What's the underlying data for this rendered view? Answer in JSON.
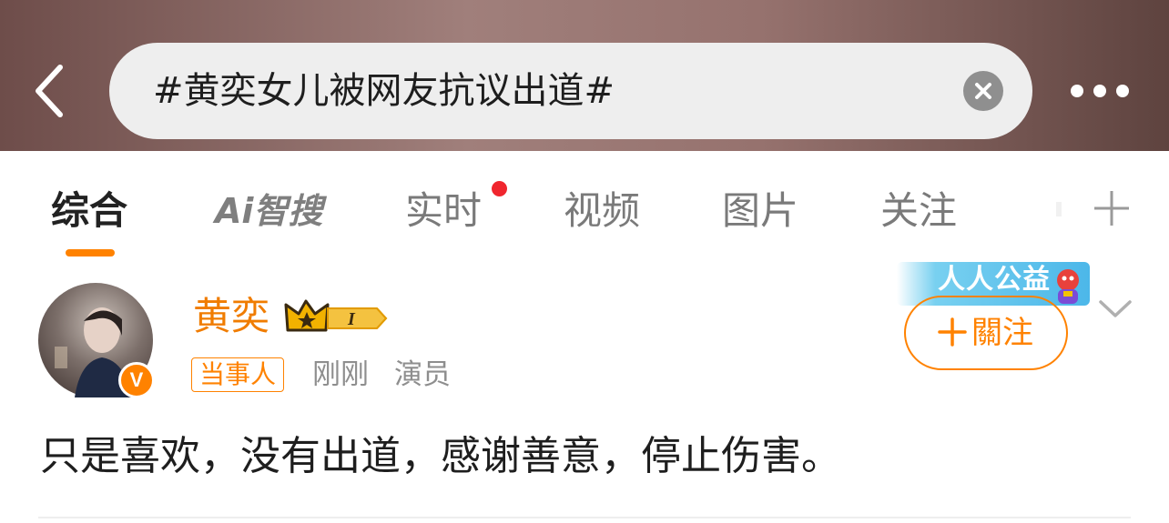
{
  "search": {
    "query": "#黄奕女儿被网友抗议出道#"
  },
  "tabs": {
    "items": [
      {
        "label": "综合",
        "active": true
      },
      {
        "label": "Ai智搜",
        "active": false
      },
      {
        "label": "实时",
        "active": false,
        "has_dot": true
      },
      {
        "label": "视频",
        "active": false
      },
      {
        "label": "图片",
        "active": false
      },
      {
        "label": "关注",
        "active": false
      }
    ]
  },
  "post": {
    "username": "黄奕",
    "level_badge": "I",
    "tag": "当事人",
    "time": "刚刚",
    "role": "演员",
    "follow_label": "關注",
    "banner_text": "人人公益",
    "content": "只是喜欢，没有出道，感谢善意，停止伤害。"
  },
  "colors": {
    "accent": "#ff8200",
    "username": "#f07c00",
    "header_bg": "#8f6c68",
    "dot": "#f0262e"
  },
  "icons": [
    "back-arrow-icon",
    "clear-icon",
    "more-icon",
    "add-icon",
    "crown-icon",
    "verified-icon",
    "plus-icon",
    "chevron-down-icon"
  ]
}
